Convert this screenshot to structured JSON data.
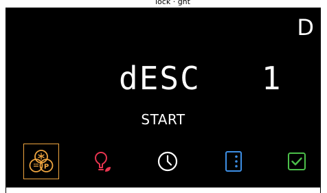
{
  "top_cut_text": "lock · ght",
  "mode_letter": "D",
  "display": {
    "text": "dESC   1"
  },
  "status_label": "START",
  "icons": [
    {
      "name": "freeze-pressure-icon",
      "selected": true,
      "color": "#f0a640"
    },
    {
      "name": "lightbulb-leaf-icon",
      "selected": false,
      "color": "#e8344f"
    },
    {
      "name": "clock-icon",
      "selected": false,
      "color": "#ffffff"
    },
    {
      "name": "door-dots-icon",
      "selected": false,
      "color": "#3d8fe6"
    },
    {
      "name": "checkbox-icon",
      "selected": false,
      "color": "#4cc04a"
    }
  ],
  "colors": {
    "background": "#000000",
    "accent": "#f0a640",
    "text": "#ffffff"
  }
}
